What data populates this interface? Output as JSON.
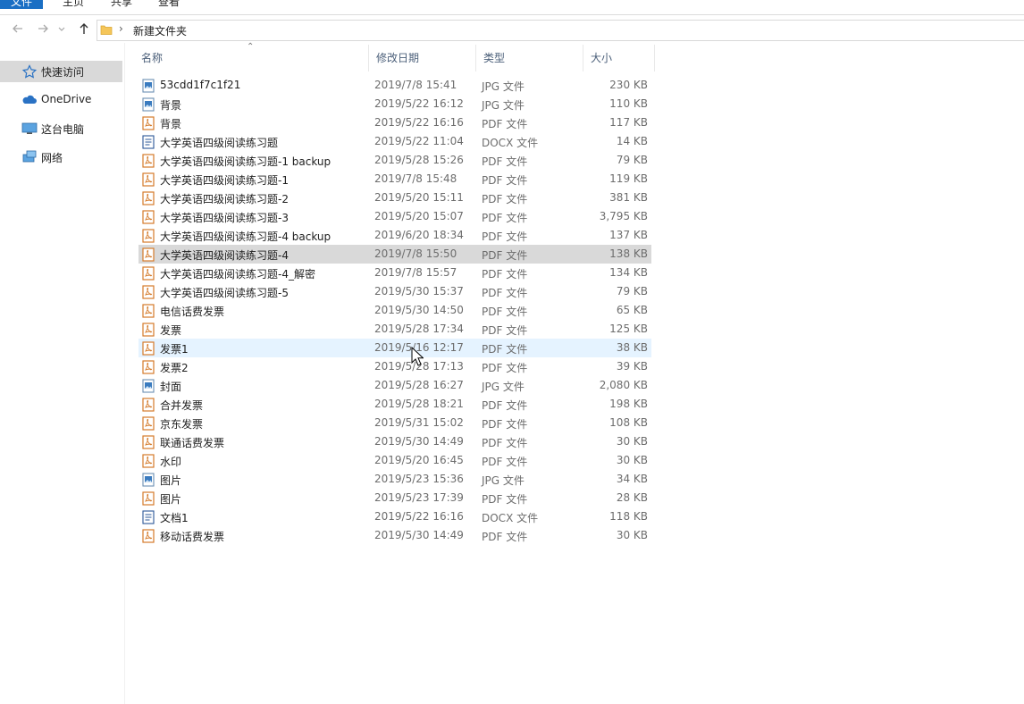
{
  "ribbon": {
    "tabs": [
      "文件",
      "主页",
      "共享",
      "查看"
    ]
  },
  "nav": {
    "path": "新建文件夹"
  },
  "sidebar": {
    "items": [
      {
        "label": "快速访问",
        "icon": "star-icon"
      },
      {
        "label": "OneDrive",
        "icon": "cloud-icon"
      },
      {
        "label": "这台电脑",
        "icon": "computer-icon"
      },
      {
        "label": "网络",
        "icon": "network-icon"
      }
    ]
  },
  "columns": {
    "name": "名称",
    "date": "修改日期",
    "type": "类型",
    "size": "大小"
  },
  "files": [
    {
      "name": "53cdd1f7c1f21",
      "date": "2019/7/8 15:41",
      "type": "JPG 文件",
      "size": "230 KB",
      "kind": "jpg"
    },
    {
      "name": "背景",
      "date": "2019/5/22 16:12",
      "type": "JPG 文件",
      "size": "110 KB",
      "kind": "jpg"
    },
    {
      "name": "背景",
      "date": "2019/5/22 16:16",
      "type": "PDF 文件",
      "size": "117 KB",
      "kind": "pdf"
    },
    {
      "name": "大学英语四级阅读练习题",
      "date": "2019/5/22 11:04",
      "type": "DOCX 文件",
      "size": "14 KB",
      "kind": "docx"
    },
    {
      "name": "大学英语四级阅读练习题-1 backup",
      "date": "2019/5/28 15:26",
      "type": "PDF 文件",
      "size": "79 KB",
      "kind": "pdf"
    },
    {
      "name": "大学英语四级阅读练习题-1",
      "date": "2019/7/8 15:48",
      "type": "PDF 文件",
      "size": "119 KB",
      "kind": "pdf"
    },
    {
      "name": "大学英语四级阅读练习题-2",
      "date": "2019/5/20 15:11",
      "type": "PDF 文件",
      "size": "381 KB",
      "kind": "pdf"
    },
    {
      "name": "大学英语四级阅读练习题-3",
      "date": "2019/5/20 15:07",
      "type": "PDF 文件",
      "size": "3,795 KB",
      "kind": "pdf"
    },
    {
      "name": "大学英语四级阅读练习题-4 backup",
      "date": "2019/6/20 18:34",
      "type": "PDF 文件",
      "size": "137 KB",
      "kind": "pdf"
    },
    {
      "name": "大学英语四级阅读练习题-4",
      "date": "2019/7/8 15:50",
      "type": "PDF 文件",
      "size": "138 KB",
      "kind": "pdf",
      "selected": true
    },
    {
      "name": "大学英语四级阅读练习题-4_解密",
      "date": "2019/7/8 15:57",
      "type": "PDF 文件",
      "size": "134 KB",
      "kind": "pdf"
    },
    {
      "name": "大学英语四级阅读练习题-5",
      "date": "2019/5/30 15:37",
      "type": "PDF 文件",
      "size": "79 KB",
      "kind": "pdf"
    },
    {
      "name": "电信话费发票",
      "date": "2019/5/30 14:50",
      "type": "PDF 文件",
      "size": "65 KB",
      "kind": "pdf"
    },
    {
      "name": "发票",
      "date": "2019/5/28 17:34",
      "type": "PDF 文件",
      "size": "125 KB",
      "kind": "pdf"
    },
    {
      "name": "发票1",
      "date": "2019/5/16 12:17",
      "type": "PDF 文件",
      "size": "38 KB",
      "kind": "pdf",
      "hovered": true
    },
    {
      "name": "发票2",
      "date": "2019/5/28 17:13",
      "type": "PDF 文件",
      "size": "39 KB",
      "kind": "pdf"
    },
    {
      "name": "封面",
      "date": "2019/5/28 16:27",
      "type": "JPG 文件",
      "size": "2,080 KB",
      "kind": "jpg"
    },
    {
      "name": "合并发票",
      "date": "2019/5/28 18:21",
      "type": "PDF 文件",
      "size": "198 KB",
      "kind": "pdf"
    },
    {
      "name": "京东发票",
      "date": "2019/5/31 15:02",
      "type": "PDF 文件",
      "size": "108 KB",
      "kind": "pdf"
    },
    {
      "name": "联通话费发票",
      "date": "2019/5/30 14:49",
      "type": "PDF 文件",
      "size": "30 KB",
      "kind": "pdf"
    },
    {
      "name": "水印",
      "date": "2019/5/20 16:45",
      "type": "PDF 文件",
      "size": "30 KB",
      "kind": "pdf"
    },
    {
      "name": "图片",
      "date": "2019/5/23 15:36",
      "type": "JPG 文件",
      "size": "34 KB",
      "kind": "jpg"
    },
    {
      "name": "图片",
      "date": "2019/5/23 17:39",
      "type": "PDF 文件",
      "size": "28 KB",
      "kind": "pdf"
    },
    {
      "name": "文档1",
      "date": "2019/5/22 16:16",
      "type": "DOCX 文件",
      "size": "118 KB",
      "kind": "docx"
    },
    {
      "name": "移动话费发票",
      "date": "2019/5/30 14:49",
      "type": "PDF 文件",
      "size": "30 KB",
      "kind": "pdf"
    }
  ],
  "colors": {
    "accent": "#1a6fc4",
    "selected_row": "#d9d9d9",
    "hover_row": "#e5f3ff",
    "pdf_icon": "#d47a2a",
    "doc_icon": "#2b5797",
    "jpg_icon": "#3a7bbf"
  }
}
